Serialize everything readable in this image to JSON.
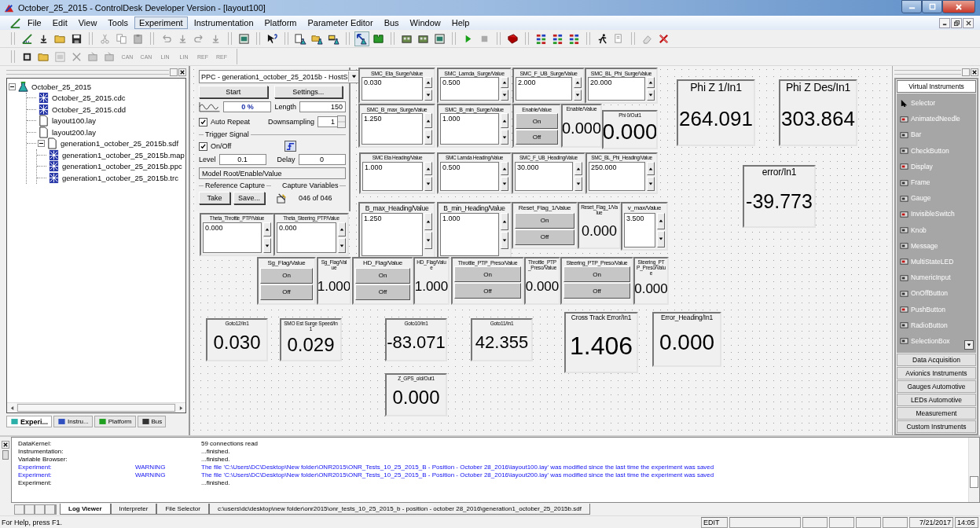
{
  "window": {
    "title": "October_25_2015 - ControlDesk Developer Version - [layout100]"
  },
  "menu": [
    {
      "label": "File",
      "selected": false
    },
    {
      "label": "Edit",
      "selected": false
    },
    {
      "label": "View",
      "selected": false
    },
    {
      "label": "Tools",
      "selected": false
    },
    {
      "label": "Experiment",
      "selected": true
    },
    {
      "label": "Instrumentation",
      "selected": false
    },
    {
      "label": "Platform",
      "selected": false
    },
    {
      "label": "Parameter Editor",
      "selected": false
    },
    {
      "label": "Bus",
      "selected": false
    },
    {
      "label": "Window",
      "selected": false
    },
    {
      "label": "Help",
      "selected": false
    }
  ],
  "toolbar2_labels": [
    "CAN",
    "CAN",
    "LIN",
    "LIN",
    "REF",
    "REF"
  ],
  "tree": [
    {
      "label": "October_25_2015",
      "kind": "experiment",
      "expanded": true,
      "children": [
        {
          "label": "October_25_2015.cdc",
          "kind": "data"
        },
        {
          "label": "October_25_2015.cdd",
          "kind": "data"
        },
        {
          "label": "layout100.lay",
          "kind": "file"
        },
        {
          "label": "layout200.lay",
          "kind": "file"
        },
        {
          "label": "generation1_october_25_2015b.sdf",
          "kind": "file",
          "expanded": true,
          "children": [
            {
              "label": "generation1_october_25_2015b.map",
              "kind": "data"
            },
            {
              "label": "generation1_october_25_2015b.ppc",
              "kind": "data"
            },
            {
              "label": "generation1_october_25_2015b.trc",
              "kind": "data"
            }
          ]
        }
      ]
    }
  ],
  "tree_tabs": [
    {
      "label": "Experi...",
      "selected": true
    },
    {
      "label": "Instru...",
      "selected": false
    },
    {
      "label": "Platform",
      "selected": false
    },
    {
      "label": "Bus",
      "selected": false
    }
  ],
  "capture": {
    "platform": "PPC - generation1_october_25_2015b - HostS",
    "start": "Start",
    "settings": "Settings...",
    "progress": "0 %",
    "length_label": "Length",
    "length": "150",
    "auto_repeat": {
      "label": "Auto Repeat",
      "checked": true
    },
    "downsampling_label": "Downsampling",
    "downsampling": "1",
    "trigger_title": "Trigger Signal",
    "trigger_on": {
      "label": "On/Off",
      "checked": true
    },
    "level_label": "Level",
    "level_value": "0.1",
    "delay_label": "Delay",
    "delay": "0",
    "variable": "Model Root/Enable/Value",
    "reference_title": "Reference Capture",
    "variables_title": "Capture Variables",
    "take": "Take",
    "save": "Save...",
    "count": "046 of 046"
  },
  "instruments": [
    {
      "kind": "numeric",
      "title": "SMC_Eta_Surge/Value",
      "value": "0.030"
    },
    {
      "kind": "numeric",
      "title": "SMC_Lamda_Surge/Value",
      "value": "0.500"
    },
    {
      "kind": "numeric",
      "title": "SMC_F_UB_Surge/Value",
      "value": "2.000"
    },
    {
      "kind": "numeric",
      "title": "SMC_BL_Phi_Surge/Value",
      "value": "20.000"
    },
    {
      "kind": "numeric",
      "title": "SMC_B_max_Surge/Value",
      "value": "1.250"
    },
    {
      "kind": "numeric",
      "title": "SMC_B_min_Surge/Value",
      "value": "1.000"
    },
    {
      "kind": "onoff",
      "title": "Enable/Value",
      "on": "On",
      "off": "Off"
    },
    {
      "kind": "display",
      "title": "Enable/Value",
      "value": "0.000"
    },
    {
      "kind": "display",
      "title": "Phi 0/Out1",
      "value": "0.000"
    },
    {
      "kind": "display",
      "title": "Phi Z 1/In1",
      "value": "264.091"
    },
    {
      "kind": "display",
      "title": "Phi Z Des/In1",
      "value": "303.864"
    },
    {
      "kind": "numeric",
      "title": "SMC Eta Heading/Value",
      "value": "1.000"
    },
    {
      "kind": "numeric",
      "title": "SMC Lamda Heading/Value",
      "value": "0.500"
    },
    {
      "kind": "numeric",
      "title": "SMC_F_UB_Heading/Value",
      "value": "30.000"
    },
    {
      "kind": "numeric",
      "title": "SMC_BL_Phi_Heading/Value",
      "value": "250.000"
    },
    {
      "kind": "display",
      "title": "error/In1",
      "value": "-39.773"
    },
    {
      "kind": "numeric",
      "title": "B_max_Heading/Value",
      "value": "1.250"
    },
    {
      "kind": "numeric",
      "title": "B_min_Heading/Value",
      "value": "1.000"
    },
    {
      "kind": "onoff",
      "title": "Reset_Flag_1/Value",
      "on": "On",
      "off": "Off"
    },
    {
      "kind": "display",
      "title": "Reset_Flag_1/Value",
      "value": "0.000"
    },
    {
      "kind": "numeric",
      "title": "v_max/Value",
      "value": "3.500"
    },
    {
      "kind": "numeric",
      "title": "Theta_Throttle_PTP/Value",
      "value": "0.000"
    },
    {
      "kind": "numeric",
      "title": "Theta_Steering_PTP/Value",
      "value": "0.000"
    },
    {
      "kind": "onoff",
      "title": "Sg_Flag/Value",
      "on": "On",
      "off": "Off"
    },
    {
      "kind": "display",
      "title": "Sg_Flag/Value",
      "value": "1.000"
    },
    {
      "kind": "onoff",
      "title": "HD_Flag/Value",
      "on": "On",
      "off": "Off"
    },
    {
      "kind": "display",
      "title": "HD_Flag/Value",
      "value": "1.000"
    },
    {
      "kind": "onoff",
      "title": "Throttle_PTP_Preso/Value",
      "on": "On",
      "off": "Off"
    },
    {
      "kind": "display",
      "title": "Throttle_PTP_Preso/Value",
      "value": "0.000"
    },
    {
      "kind": "onoff",
      "title": "Steering_PTP_Preso/Value",
      "on": "On",
      "off": "Off"
    },
    {
      "kind": "display",
      "title": "Steering_PTP_Preso/Value",
      "value": "0.000"
    },
    {
      "kind": "display",
      "title": "Goto12/In1",
      "value": "0.030"
    },
    {
      "kind": "display",
      "title": "SMO Est Surge Speed/In1",
      "value": "0.029"
    },
    {
      "kind": "display",
      "title": "Goto10/In1",
      "value": "-83.071"
    },
    {
      "kind": "display",
      "title": "Goto11/In1",
      "value": "42.355"
    },
    {
      "kind": "display",
      "title": "Cross Track Error/In1",
      "value": "1.406"
    },
    {
      "kind": "display",
      "title": "Error_Heading/In1",
      "value": "0.000"
    },
    {
      "kind": "display",
      "title": "Z_GPS_old/Out1",
      "value": "0.000"
    }
  ],
  "palette": {
    "groups": [
      {
        "label": "Virtual Instruments",
        "selected": true,
        "items": [
          "Selector",
          "AnimatedNeedle",
          "Bar",
          "CheckButton",
          "Display",
          "Frame",
          "Gauge",
          "InvisibleSwitch",
          "Knob",
          "Message",
          "MultiStateLED",
          "NumericInput",
          "OnOffButton",
          "PushButton",
          "RadioButton",
          "SelectionBox"
        ]
      },
      {
        "label": "Data Acquisition",
        "selected": false
      },
      {
        "label": "Avionics Instruments",
        "selected": false
      },
      {
        "label": "Gauges Automotive",
        "selected": false
      },
      {
        "label": "LEDs Automotive",
        "selected": false
      },
      {
        "label": "Measurement",
        "selected": false
      },
      {
        "label": "Custom Instruments",
        "selected": false
      }
    ]
  },
  "log": [
    {
      "source": "DataKernel:",
      "kind": "info",
      "message": "59 connections read"
    },
    {
      "source": "Instrumentation:",
      "kind": "info",
      "message": "...finished."
    },
    {
      "source": "Variable Browser:",
      "kind": "info",
      "message": "...finished."
    },
    {
      "source": "Experiment:",
      "kind": "warning",
      "level": "WARNING",
      "message": "The file 'C:\\Users\\DC\\Desktop\\New folder\\ONR2015\\ONR_Tests_10_25_2015_B - Position - October 28_2016\\layout100.lay' was modified since the last time the experiment was saved"
    },
    {
      "source": "Experiment:",
      "kind": "warning",
      "level": "WARNING",
      "message": "The file 'C:\\Users\\DC\\Desktop\\New folder\\ONR2015\\ONR_Tests_10_25_2015_B - Position - October 28_2016\\layout200.lay' was modified since the last time the experiment was saved"
    },
    {
      "source": "Experiment:",
      "kind": "info",
      "message": "...finished."
    }
  ],
  "log_tabs": [
    {
      "label": "Log Viewer",
      "selected": true
    },
    {
      "label": "Interpreter",
      "selected": false
    },
    {
      "label": "File Selector",
      "selected": false
    },
    {
      "label": "c:\\users\\dc\\desktop\\new folder\\onr2015\\onr_tests_10_25_2015_b - position - october 28_2016\\generation1_october_25_2015b.sdf",
      "selected": false
    }
  ],
  "status_bar": {
    "help": "For Help, press F1.",
    "mode": "EDIT",
    "date": "7/21/2017",
    "time": "14:05"
  }
}
